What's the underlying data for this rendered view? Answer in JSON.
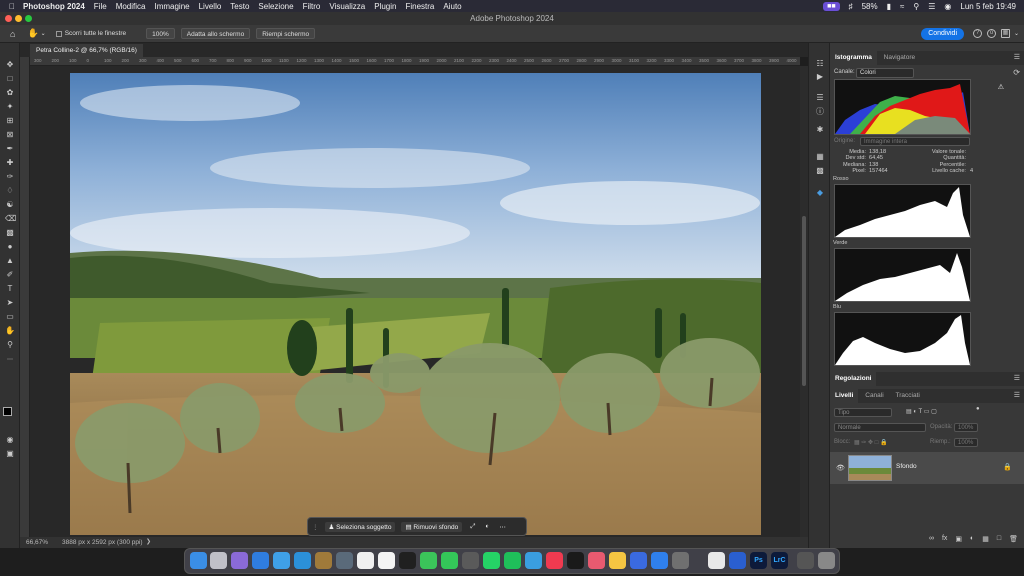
{
  "menubar": {
    "app_name": "Photoshop 2024",
    "items": [
      "File",
      "Modifica",
      "Immagine",
      "Livello",
      "Testo",
      "Selezione",
      "Filtro",
      "Visualizza",
      "Plugin",
      "Finestra",
      "Aiuto"
    ],
    "battery": "58%",
    "datetime": "Lun 5 feb  19:49"
  },
  "titlebar": {
    "title": "Adobe Photoshop 2024"
  },
  "options": {
    "scroll_all_label": "Scorri tutte le finestre",
    "zoom_100": "100%",
    "fit_screen": "Adatta allo schermo",
    "fill_screen": "Riempi schermo",
    "share": "Condividi"
  },
  "document": {
    "tab_title": "Petra Colline-2 @ 66,7% (RGB/16)",
    "zoom": "66,67%",
    "dimensions": "3888 px x 2592 px (300 ppi)"
  },
  "ruler": {
    "ticks": [
      "300",
      "200",
      "100",
      "0",
      "100",
      "200",
      "300",
      "400",
      "500",
      "600",
      "700",
      "800",
      "900",
      "1000",
      "1100",
      "1200",
      "1300",
      "1400",
      "1500",
      "1600",
      "1700",
      "1800",
      "1900",
      "2000",
      "2100",
      "2200",
      "2300",
      "2400",
      "2500",
      "2600",
      "2700",
      "2800",
      "2900",
      "3000",
      "3100",
      "3200",
      "3300",
      "3400",
      "3500",
      "3600",
      "3700",
      "3800",
      "3900",
      "4000"
    ]
  },
  "context_bar": {
    "select_subject": "Seleziona soggetto",
    "remove_bg": "Rimuovi sfondo"
  },
  "histogram": {
    "tabs": [
      "Istogramma",
      "Navigatore"
    ],
    "channel_label": "Canale:",
    "channel_value": "Colori",
    "source_label": "Origine:",
    "source_value": "Immagine intera",
    "stats_left_labels": [
      "Media:",
      "Dev std:",
      "Mediana:",
      "Pixel:"
    ],
    "stats_left_values": [
      "138,18",
      "64,45",
      "138",
      "157464"
    ],
    "stats_right_labels": [
      "Valore tonale:",
      "Quantità:",
      "Percentile:",
      "Livello cache:"
    ],
    "stats_right_values": [
      "",
      "",
      "",
      "4"
    ],
    "channels": [
      "Rosso",
      "Verde",
      "Blu"
    ]
  },
  "adjustments": {
    "title": "Regolazioni"
  },
  "layers": {
    "tabs": [
      "Livelli",
      "Canali",
      "Tracciati"
    ],
    "kind_placeholder": "Tipo",
    "blend_mode": "Normale",
    "opacity_label": "Opacità:",
    "opacity_value": "100%",
    "lock_label": "Blocc:",
    "fill_label": "Riemp.:",
    "fill_value": "100%",
    "layer_name": "Sfondo"
  },
  "colors": {
    "accent": "#1473e6",
    "ps_purple": "#6a4fd6"
  }
}
